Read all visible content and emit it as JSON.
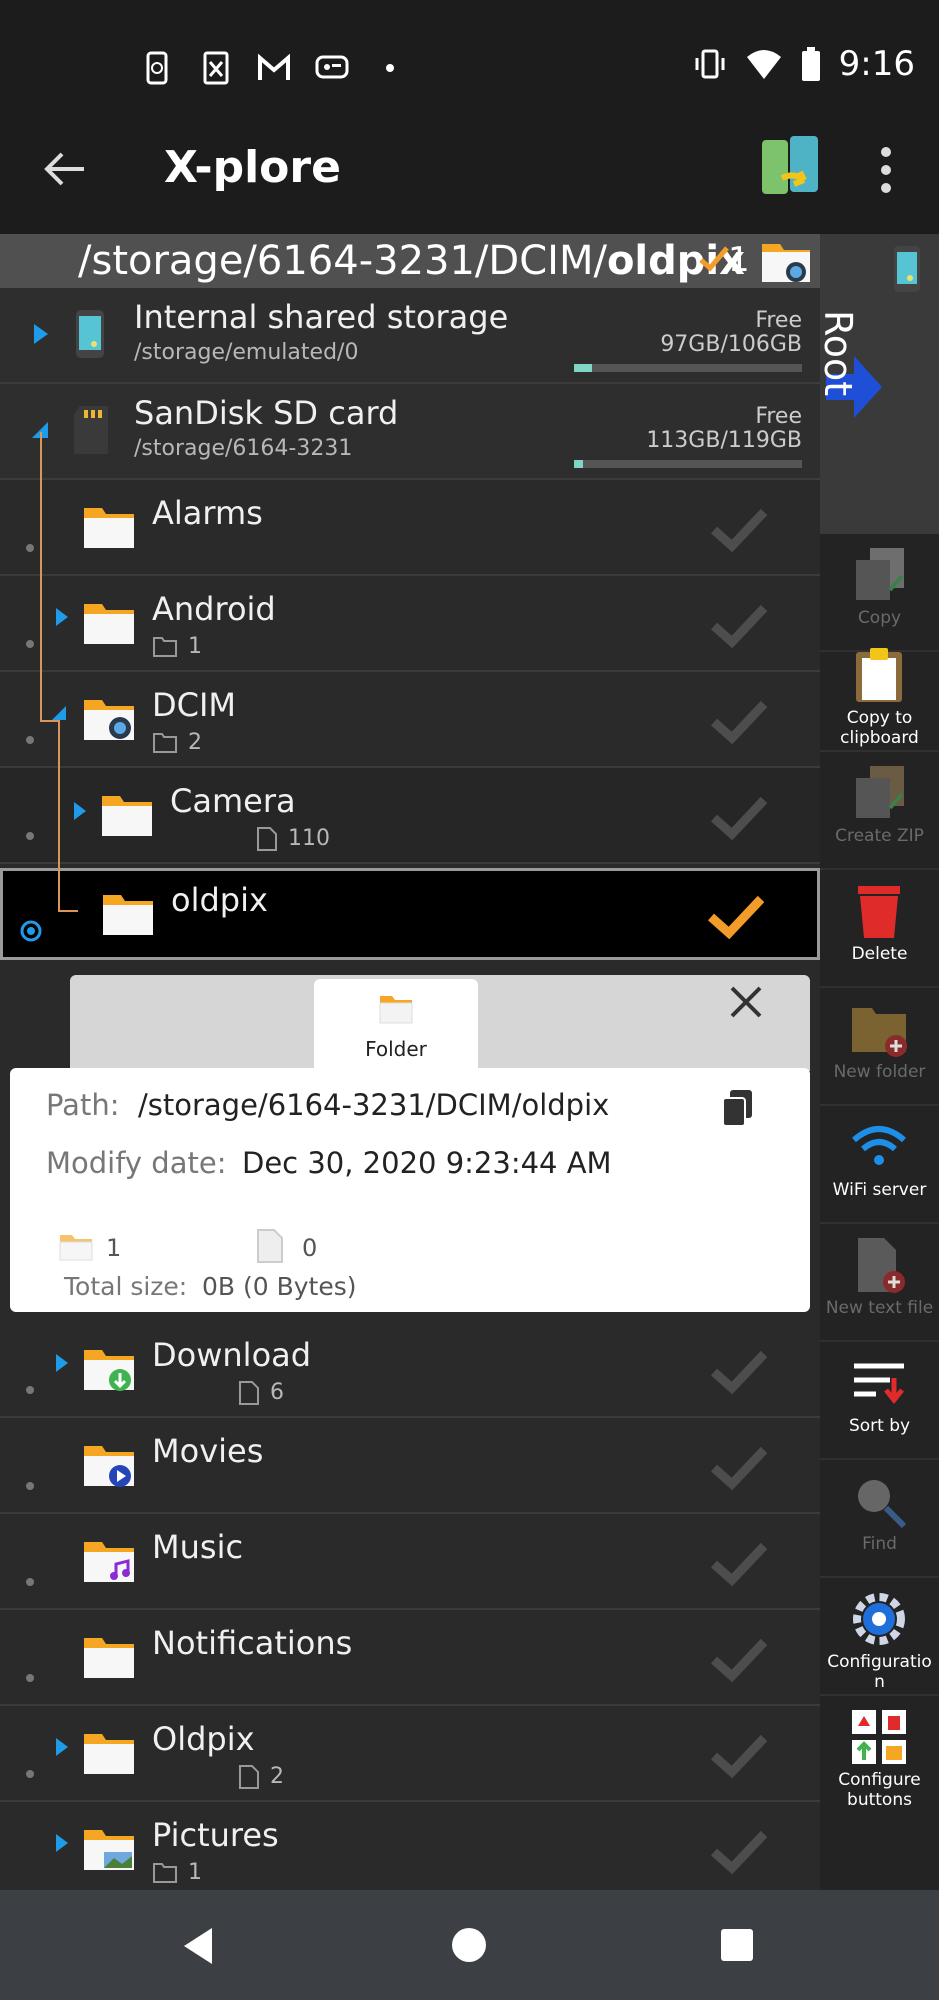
{
  "status_bar": {
    "time": "9:16"
  },
  "app_bar": {
    "title": "X-plore"
  },
  "path_bar": {
    "path_prefix": "/storage/6164-3231/DCIM/",
    "path_current": "oldpix",
    "marked_count": "1"
  },
  "volumes": [
    {
      "name": "Internal shared storage",
      "path": "/storage/emulated/0",
      "free_label": "Free",
      "free_value": "97GB/106GB",
      "used_fraction": 0.08
    },
    {
      "name": "SanDisk SD card",
      "path": "/storage/6164-3231",
      "free_label": "Free",
      "free_value": "113GB/119GB",
      "used_fraction": 0.04
    }
  ],
  "folders_top": [
    {
      "name": "Alarms",
      "count": ""
    },
    {
      "name": "Android",
      "count": "1"
    },
    {
      "name": "DCIM",
      "count": "2"
    },
    {
      "name": "Camera",
      "count": "110"
    },
    {
      "name": "oldpix",
      "count": ""
    }
  ],
  "folders_bottom": [
    {
      "name": "Download",
      "count": "6"
    },
    {
      "name": "Movies",
      "count": ""
    },
    {
      "name": "Music",
      "count": ""
    },
    {
      "name": "Notifications",
      "count": ""
    },
    {
      "name": "Oldpix",
      "count": "2"
    },
    {
      "name": "Pictures",
      "count": "1"
    }
  ],
  "sidebar": {
    "root_label": "Root",
    "buttons": [
      {
        "label": "Copy",
        "enabled": false
      },
      {
        "label": "Copy to clipboard",
        "enabled": true
      },
      {
        "label": "Create ZIP",
        "enabled": false
      },
      {
        "label": "Delete",
        "enabled": true
      },
      {
        "label": "New folder",
        "enabled": false
      },
      {
        "label": "WiFi server",
        "enabled": true
      },
      {
        "label": "New text file",
        "enabled": false
      },
      {
        "label": "Sort by",
        "enabled": true
      },
      {
        "label": "Find",
        "enabled": false
      },
      {
        "label": "Configuratio n",
        "enabled": true
      },
      {
        "label": "Configure buttons",
        "enabled": true
      }
    ]
  },
  "details_dialog": {
    "tab_label": "Folder",
    "path_label": "Path:",
    "path_value": "/storage/6164-3231/DCIM/oldpix",
    "modify_label": "Modify date:",
    "modify_value": "Dec 30, 2020 9:23:44 AM",
    "folder_count": "1",
    "file_count": "0",
    "total_size_label": "Total size:",
    "total_size_value": "0B (0 Bytes)"
  },
  "colors": {
    "accent_orange": "#f39c2a",
    "expander_blue": "#1e9be9",
    "tree_line": "#d9955a"
  }
}
